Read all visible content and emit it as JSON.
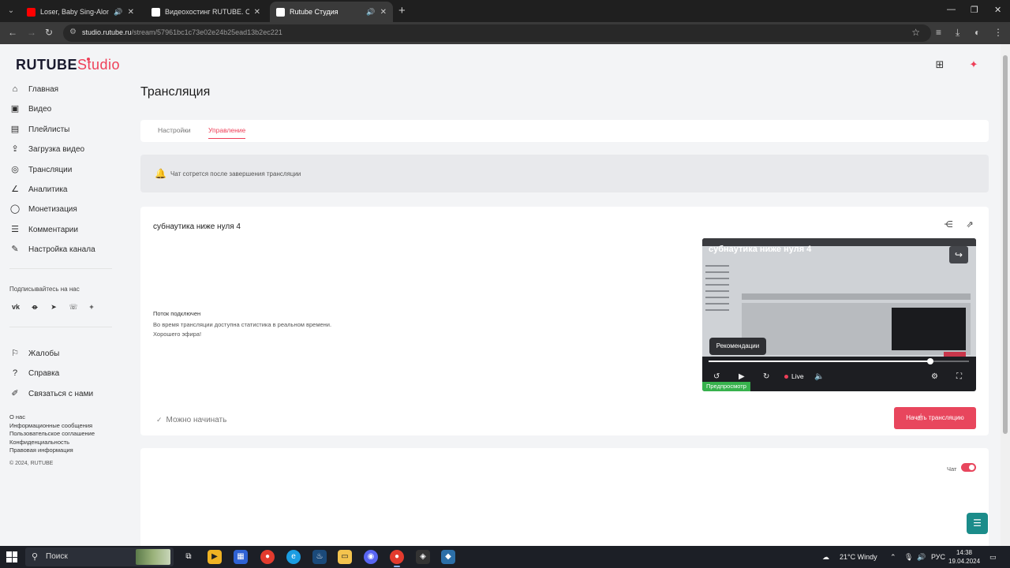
{
  "browser": {
    "tabs": [
      {
        "title": "Loser, Baby Sing-Along | H",
        "favicon_color": "#ff0000",
        "has_sound": true
      },
      {
        "title": "Видеохостинг RUTUBE. Смотр",
        "favicon_color": "#ffffff",
        "has_sound": false
      },
      {
        "title": "Rutube Студия",
        "favicon_color": "#ffffff",
        "has_sound": true
      }
    ],
    "url_host": "studio.rutube.ru",
    "url_path": "/stream/57961bc1c73e02e24b25ead13b2ec221"
  },
  "brand": {
    "name": "RUTUBE",
    "suffix": "Studio",
    "accent": "#ee3f58"
  },
  "sidebar": {
    "items": [
      {
        "label": "Главная",
        "icon": "home-icon"
      },
      {
        "label": "Видео",
        "icon": "video-icon"
      },
      {
        "label": "Плейлисты",
        "icon": "playlist-icon"
      },
      {
        "label": "Загрузка видео",
        "icon": "upload-icon"
      },
      {
        "label": "Трансляции",
        "icon": "broadcast-icon"
      },
      {
        "label": "Аналитика",
        "icon": "analytics-icon"
      },
      {
        "label": "Монетизация",
        "icon": "monetization-icon"
      },
      {
        "label": "Комментарии",
        "icon": "comments-icon"
      },
      {
        "label": "Настройка канала",
        "icon": "channel-settings-icon"
      }
    ],
    "subscribe_label": "Подписывайтесь на нас",
    "socials": [
      "vk-icon",
      "ok-icon",
      "telegram-icon",
      "viber-icon",
      "more-icon"
    ],
    "support_items": [
      {
        "label": "Жалобы",
        "icon": "complaint-icon"
      },
      {
        "label": "Справка",
        "icon": "help-icon"
      },
      {
        "label": "Связаться с нами",
        "icon": "contact-icon"
      }
    ],
    "footer_links": [
      "О нас",
      "Информационные сообщения",
      "Пользовательское соглашение",
      "Конфиденциальность",
      "Правовая информация"
    ],
    "copyright": "© 2024, RUTUBE"
  },
  "main": {
    "title": "Трансляция",
    "tabs": [
      {
        "label": "Настройки",
        "active": false
      },
      {
        "label": "Управление",
        "active": true
      }
    ],
    "notice": "Чат сотрется после завершения трансляции",
    "stream": {
      "title": "субнаутика ниже нуля 4",
      "status_title": "Поток подключен",
      "status_line1": "Во время трансляции доступна статистика в реальном времени.",
      "status_line2": "Хорошего эфира!",
      "ready_label": "Можно начинать",
      "player": {
        "title": "субнаутика ниже нуля 4",
        "recommend_label": "Рекомендации",
        "live_label": "Live",
        "preview_badge": "Предпросмотр",
        "progress": 0.85
      },
      "start_button": "Начать трансляцию"
    },
    "chat": {
      "label": "Чат",
      "enabled": true
    }
  },
  "taskbar": {
    "search_label": "Поиск",
    "weather": "21°C Windy",
    "lang": "РУС",
    "time": "14:38",
    "date": "19.04.2024"
  }
}
